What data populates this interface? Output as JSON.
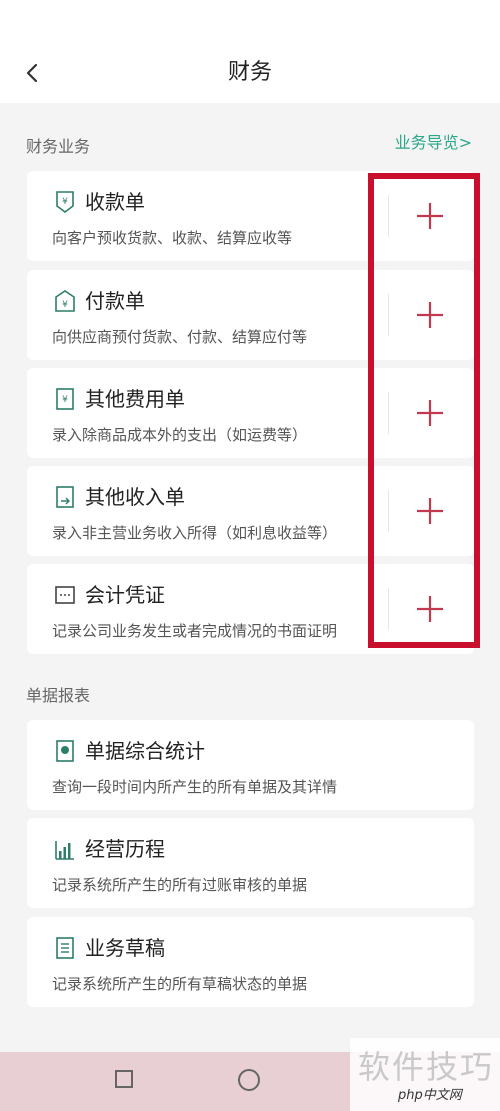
{
  "header": {
    "title": "财务",
    "back_icon": "chevron-left-icon"
  },
  "finance_section": {
    "title": "财务业务",
    "guide_link": "业务导览>",
    "items": [
      {
        "name": "收款单",
        "desc": "向客户预收货款、收款、结算应收等",
        "icon": "receipt-icon"
      },
      {
        "name": "付款单",
        "desc": "向供应商预付货款、付款、结算应付等",
        "icon": "payment-icon"
      },
      {
        "name": "其他费用单",
        "desc": "录入除商品成本外的支出（如运费等）",
        "icon": "expense-icon"
      },
      {
        "name": "其他收入单",
        "desc": "录入非主营业务收入所得（如利息收益等）",
        "icon": "income-icon"
      },
      {
        "name": "会计凭证",
        "desc": "记录公司业务发生或者完成情况的书面证明",
        "icon": "voucher-icon"
      }
    ]
  },
  "report_section": {
    "title": "单据报表",
    "items": [
      {
        "name": "单据综合统计",
        "desc": "查询一段时间内所产生的所有单据及其详情",
        "icon": "document-stats-icon"
      },
      {
        "name": "经营历程",
        "desc": "记录系统所产生的所有过账审核的单据",
        "icon": "bar-chart-icon"
      },
      {
        "name": "业务草稿",
        "desc": "记录系统所产生的所有草稿状态的单据",
        "icon": "draft-icon"
      }
    ]
  },
  "colors": {
    "accent_green": "#2aa68a",
    "plus_red": "#c0394f",
    "highlight_red": "#c8102e",
    "icon_green": "#2e7d6b"
  },
  "watermark": {
    "text": "软件技巧",
    "logo": "php中文网"
  }
}
